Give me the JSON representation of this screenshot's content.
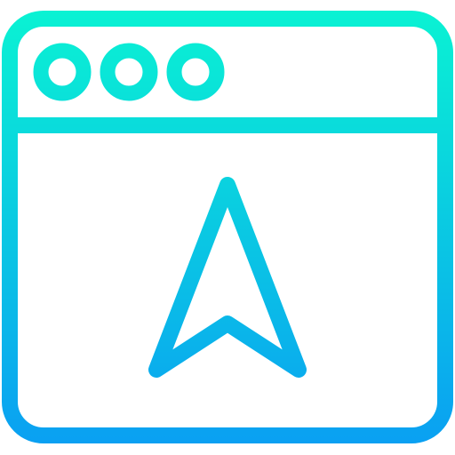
{
  "icon": {
    "name": "browser-window-navigation-icon",
    "gradient": {
      "top_color": "#0af2d3",
      "bottom_color": "#0aa0f2"
    },
    "fill_color": "#ffffff"
  }
}
